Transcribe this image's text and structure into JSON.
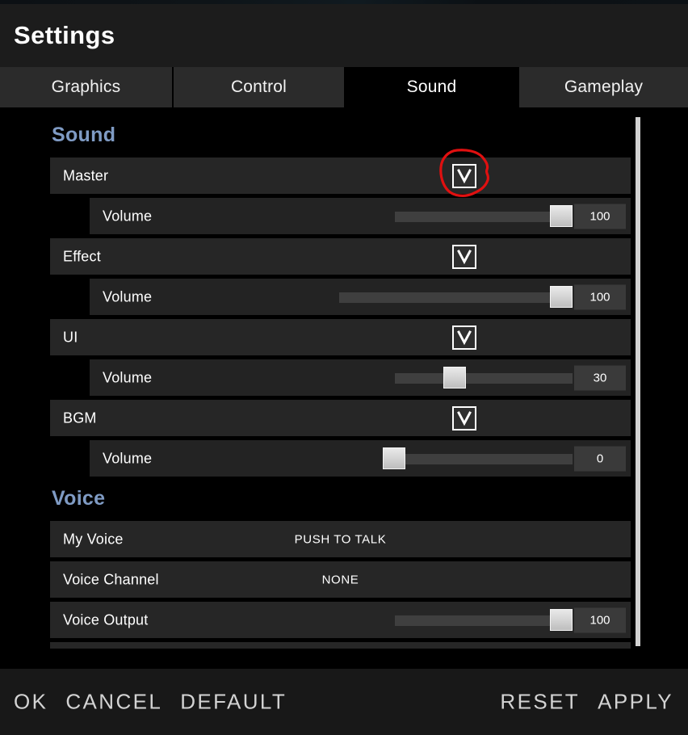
{
  "window": {
    "title": "Settings"
  },
  "tabs": [
    {
      "label": "Graphics",
      "active": false
    },
    {
      "label": "Control",
      "active": false
    },
    {
      "label": "Sound",
      "active": true
    },
    {
      "label": "Gameplay",
      "active": false
    }
  ],
  "sections": [
    {
      "title": "Sound",
      "rows": [
        {
          "label": "Master",
          "control": "checkbox",
          "checked": true,
          "glyph": "check-v"
        },
        {
          "label": "Volume",
          "control": "slider",
          "value": "100",
          "percent": 100,
          "indent": 1
        },
        {
          "label": "Effect",
          "control": "checkbox",
          "checked": true,
          "glyph": "check-v"
        },
        {
          "label": "Volume",
          "control": "slider",
          "value": "100",
          "percent": 100,
          "indent": 1
        },
        {
          "label": "UI",
          "control": "checkbox",
          "checked": true,
          "glyph": "check-v"
        },
        {
          "label": "Volume",
          "control": "slider",
          "value": "30",
          "percent": 30,
          "indent": 1
        },
        {
          "label": "BGM",
          "control": "checkbox",
          "checked": true,
          "glyph": "check-v"
        },
        {
          "label": "Volume",
          "control": "slider",
          "value": "0",
          "percent": 0,
          "indent": 1
        }
      ]
    },
    {
      "title": "Voice",
      "rows": [
        {
          "label": "My Voice",
          "control": "text",
          "value": "PUSH TO TALK"
        },
        {
          "label": "Voice Channel",
          "control": "text",
          "value": "NONE"
        },
        {
          "label": "Voice Output",
          "control": "slider",
          "value": "100",
          "percent": 100
        }
      ]
    }
  ],
  "footer": {
    "left_buttons": [
      "OK",
      "CANCEL",
      "DEFAULT"
    ],
    "right_buttons": [
      "RESET",
      "APPLY"
    ]
  },
  "annotation": {
    "type": "hand-drawn-circle",
    "color": "#e01010",
    "target": "Master checkbox"
  },
  "colors": {
    "accent_section": "#7f9bc4",
    "row_bg": "#262626",
    "row_bg_indent": "#232323",
    "tab_bg": "#2b2b2b",
    "tab_active_bg": "#000000",
    "titlebar_bg": "#1c1c1c",
    "footer_bg": "#181818",
    "thumb": "#d2d2d2",
    "annotation_red": "#e01010"
  }
}
